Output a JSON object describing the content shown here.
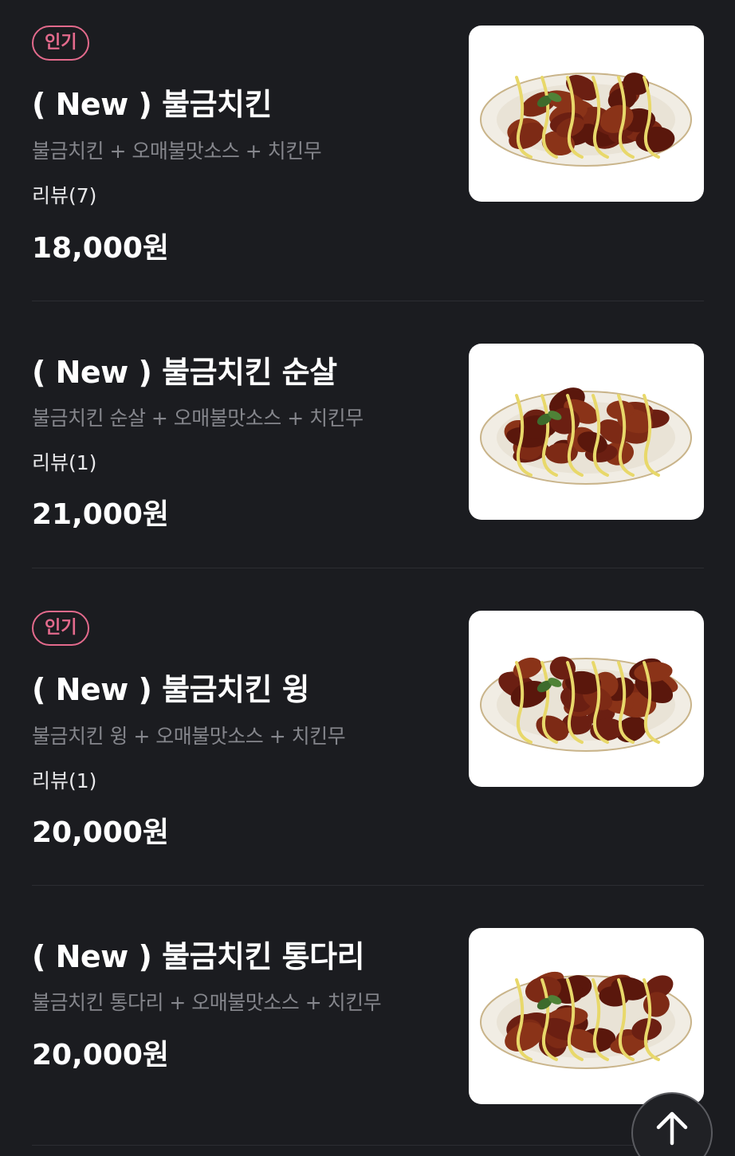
{
  "items": [
    {
      "badge": "인기",
      "name": "( New ) 불금치킨",
      "description": "불금치킨 + 오매불맛소스 + 치킨무",
      "review": "리뷰(7)",
      "price": "18,000원",
      "image": "bone-in-chicken-plate"
    },
    {
      "badge": "",
      "name": "( New ) 불금치킨 순살",
      "description": "불금치킨 순살 + 오매불맛소스 + 치킨무",
      "review": "리뷰(1)",
      "price": "21,000원",
      "image": "boneless-chicken-plate"
    },
    {
      "badge": "인기",
      "name": "( New ) 불금치킨 윙",
      "description": "불금치킨 윙 + 오매불맛소스 + 치킨무",
      "review": "리뷰(1)",
      "price": "20,000원",
      "image": "wing-chicken-plate"
    },
    {
      "badge": "",
      "name": "( New ) 불금치킨 통다리",
      "description": "불금치킨 통다리 + 오매불맛소스 + 치킨무",
      "review": "",
      "price": "20,000원",
      "image": "drumstick-chicken-plate"
    }
  ],
  "scroll_top": {
    "icon": "arrow-up-icon"
  },
  "colors": {
    "background": "#1b1c20",
    "badge_accent": "#e36a8c",
    "description": "#85868c",
    "divider": "#2c2d32"
  }
}
